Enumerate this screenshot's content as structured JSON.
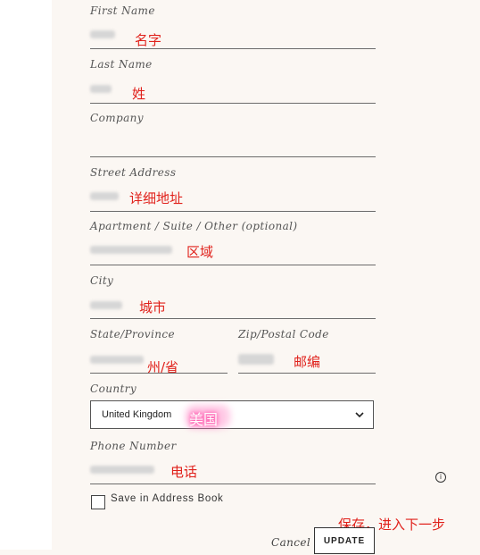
{
  "fields": {
    "first_name": {
      "label": "First Name",
      "annotation": "名字"
    },
    "last_name": {
      "label": "Last Name",
      "annotation": "姓"
    },
    "company": {
      "label": "Company"
    },
    "street": {
      "label": "Street Address",
      "annotation": "详细地址"
    },
    "apartment": {
      "label": "Apartment / Suite / Other (optional)",
      "annotation": "区域"
    },
    "city": {
      "label": "City",
      "annotation": "城市"
    },
    "state": {
      "label": "State/Province",
      "annotation": "州/省"
    },
    "zip": {
      "label": "Zip/Postal Code",
      "annotation": "邮编"
    },
    "country": {
      "label": "Country",
      "value": "United Kingdom",
      "annotation": "美国"
    },
    "phone": {
      "label": "Phone Number",
      "annotation": "电话"
    }
  },
  "save_label": "Save in Address Book",
  "save_annotation": "保存，进入下一步",
  "cancel_label": "Cancel",
  "update_label": "UPDATE",
  "icons": {
    "info": "info-icon",
    "chevron": "chevron-down-icon"
  },
  "colors": {
    "annotation": "#e0211b",
    "background": "#fbf7f3"
  }
}
